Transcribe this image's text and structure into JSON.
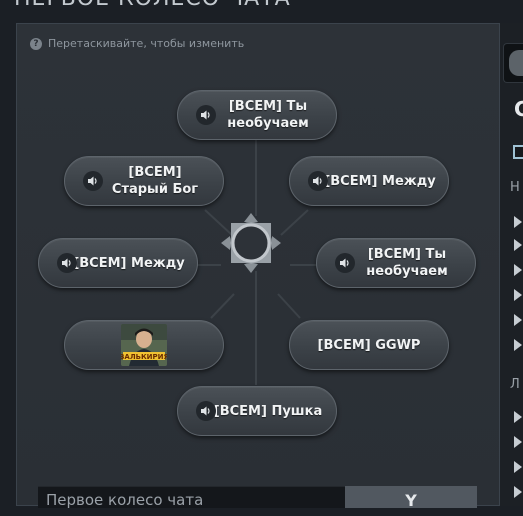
{
  "window": {
    "title": "ПЕРВОЕ КОЛЕСО ЧАТА"
  },
  "hint": {
    "icon": "question-icon",
    "text": "Перетаскивайте, чтобы изменить"
  },
  "wheel": {
    "slots": [
      {
        "id": "top",
        "label": "[ВСЕМ] Ты необучаем",
        "sound": true
      },
      {
        "id": "top-left",
        "label": "[ВСЕМ] Старый Бог",
        "sound": true
      },
      {
        "id": "top-right",
        "label": "[ВСЕМ] Между",
        "sound": true
      },
      {
        "id": "left",
        "label": "[ВСЕМ] Между",
        "sound": true
      },
      {
        "id": "right",
        "label": "[ВСЕМ] Ты необучаем",
        "sound": true
      },
      {
        "id": "bottom-left",
        "label": "",
        "sound": false,
        "sticker": "meme-sticker"
      },
      {
        "id": "bottom-right",
        "label": "[ВСЕМ] GGWP",
        "sound": false
      },
      {
        "id": "bottom",
        "label": "[ВСЕМ] Пушка",
        "sound": true
      }
    ]
  },
  "footer": {
    "input_value": "Первое колесо чата",
    "button_label": "Y"
  },
  "right_panel": {
    "heading": "С",
    "letter_1": "Н",
    "letter_2": "Л"
  },
  "colors": {
    "accent": "#9fc2d4",
    "pill_border": "#5d646b",
    "panel_bg": "#2d3238"
  }
}
